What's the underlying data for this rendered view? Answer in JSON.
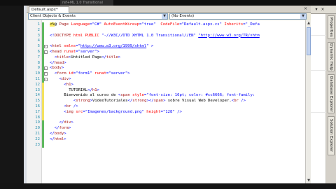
{
  "window": {
    "title": "ref+ML 1.0 Transitional"
  },
  "tab": {
    "label": "Default.aspx*",
    "close": "×"
  },
  "navbar": {
    "left_combo": "Client Objects & Events",
    "right_combo": "(No Events)"
  },
  "right_panel": {
    "tabs": [
      "Properties",
      "Dynamic Help",
      "Database Explorer",
      "Solution Explorer"
    ]
  },
  "code": {
    "lines": [
      {
        "n": "1",
        "mark": "green",
        "collapse": "",
        "indent": 0,
        "segs": [
          {
            "c": "t-asp",
            "t": "<%"
          },
          {
            "c": "t-text",
            "t": "@ "
          },
          {
            "c": "t-name",
            "t": "Page "
          },
          {
            "c": "t-attr",
            "t": "Language"
          },
          {
            "c": "t-val",
            "t": "=\"C#\" "
          },
          {
            "c": "t-attr",
            "t": "AutoEventWireup"
          },
          {
            "c": "t-val",
            "t": "=\"true\"  "
          },
          {
            "c": "t-attr",
            "t": "CodeFile"
          },
          {
            "c": "t-val",
            "t": "=\"Default.aspx.cs\" "
          },
          {
            "c": "t-attr",
            "t": "Inherits"
          },
          {
            "c": "t-val",
            "t": "=\"_Defa"
          }
        ]
      },
      {
        "n": "2",
        "mark": "green",
        "collapse": "",
        "indent": 0,
        "segs": []
      },
      {
        "n": "3",
        "mark": "green",
        "collapse": "",
        "indent": 0,
        "segs": [
          {
            "c": "t-tag",
            "t": "<!"
          },
          {
            "c": "t-name",
            "t": "DOCTYPE "
          },
          {
            "c": "t-attr",
            "t": "html PUBLIC "
          },
          {
            "c": "t-val",
            "t": "\"-//W3C//DTD XHTML 1.0 Transitional//EN\" "
          },
          {
            "c": "t-link",
            "t": "\"http://www.w3.org/TR/xhtm"
          }
        ]
      },
      {
        "n": "4",
        "mark": "green",
        "collapse": "",
        "indent": 0,
        "segs": []
      },
      {
        "n": "5",
        "mark": "green",
        "collapse": "-",
        "indent": 0,
        "segs": [
          {
            "c": "t-tag",
            "t": "<"
          },
          {
            "c": "t-name",
            "t": "html "
          },
          {
            "c": "t-attr",
            "t": "xmlns"
          },
          {
            "c": "t-val",
            "t": "=\""
          },
          {
            "c": "t-link",
            "t": "http://www.w3.org/1999/xhtml"
          },
          {
            "c": "t-val",
            "t": "\" "
          },
          {
            "c": "t-tag",
            "t": ">"
          }
        ]
      },
      {
        "n": "6",
        "mark": "green",
        "collapse": "-",
        "indent": 0,
        "segs": [
          {
            "c": "t-tag",
            "t": "<"
          },
          {
            "c": "t-name",
            "t": "head "
          },
          {
            "c": "t-attr",
            "t": "runat"
          },
          {
            "c": "t-val",
            "t": "=\"server\""
          },
          {
            "c": "t-tag",
            "t": ">"
          }
        ]
      },
      {
        "n": "7",
        "mark": "green",
        "collapse": "",
        "indent": 2,
        "segs": [
          {
            "c": "t-tag",
            "t": "<"
          },
          {
            "c": "t-name",
            "t": "title"
          },
          {
            "c": "t-tag",
            "t": ">"
          },
          {
            "c": "t-text",
            "t": "Untitled Page"
          },
          {
            "c": "t-tag",
            "t": "</"
          },
          {
            "c": "t-name",
            "t": "title"
          },
          {
            "c": "t-tag",
            "t": ">"
          }
        ]
      },
      {
        "n": "8",
        "mark": "green",
        "collapse": "",
        "indent": 0,
        "segs": [
          {
            "c": "t-tag",
            "t": "</"
          },
          {
            "c": "t-name",
            "t": "head"
          },
          {
            "c": "t-tag",
            "t": ">"
          }
        ]
      },
      {
        "n": "9",
        "mark": "green",
        "collapse": "-",
        "indent": 0,
        "segs": [
          {
            "c": "t-tag",
            "t": "<"
          },
          {
            "c": "t-name",
            "t": "body"
          },
          {
            "c": "t-tag",
            "t": ">"
          }
        ]
      },
      {
        "n": "10",
        "mark": "green",
        "collapse": "-",
        "indent": 2,
        "segs": [
          {
            "c": "t-tag",
            "t": "<"
          },
          {
            "c": "t-name",
            "t": "form "
          },
          {
            "c": "t-attr",
            "t": "id"
          },
          {
            "c": "t-val",
            "t": "=\"form1\" "
          },
          {
            "c": "t-attr",
            "t": "runat"
          },
          {
            "c": "t-val",
            "t": "=\"server\""
          },
          {
            "c": "t-tag",
            "t": ">"
          }
        ]
      },
      {
        "n": "11",
        "mark": "green",
        "collapse": "-",
        "indent": 4,
        "segs": [
          {
            "c": "t-tag",
            "t": "<"
          },
          {
            "c": "t-name",
            "t": "div"
          },
          {
            "c": "t-tag",
            "t": ">"
          }
        ]
      },
      {
        "n": "12",
        "mark": "yellow",
        "collapse": "",
        "indent": 6,
        "segs": [
          {
            "c": "t-tag",
            "t": "<"
          },
          {
            "c": "t-name",
            "t": "h1"
          },
          {
            "c": "t-tag",
            "t": ">"
          }
        ]
      },
      {
        "n": "13",
        "mark": "yellow",
        "collapse": "",
        "indent": 8,
        "segs": [
          {
            "c": "t-text",
            "t": "TUTORIAL"
          },
          {
            "c": "t-tag",
            "t": "</"
          },
          {
            "c": "t-name",
            "t": "h1"
          },
          {
            "c": "t-tag",
            "t": ">"
          }
        ]
      },
      {
        "n": "14",
        "mark": "yellow",
        "collapse": "",
        "indent": 6,
        "segs": [
          {
            "c": "t-text",
            "t": "Bienvenido al curso de "
          },
          {
            "c": "t-tag",
            "t": "<"
          },
          {
            "c": "t-name",
            "t": "span "
          },
          {
            "c": "t-attr",
            "t": "style"
          },
          {
            "c": "t-val",
            "t": "=\"font-size: 16pt; color: #cc6666; font-family:"
          }
        ]
      },
      {
        "n": "15",
        "mark": "yellow",
        "collapse": "",
        "indent": 10,
        "segs": [
          {
            "c": "t-tag",
            "t": "<"
          },
          {
            "c": "t-name",
            "t": "strong"
          },
          {
            "c": "t-tag",
            "t": ">"
          },
          {
            "c": "t-text",
            "t": "VideoTutoriales"
          },
          {
            "c": "t-tag",
            "t": "</"
          },
          {
            "c": "t-name",
            "t": "strong"
          },
          {
            "c": "t-tag",
            "t": "></"
          },
          {
            "c": "t-name",
            "t": "span"
          },
          {
            "c": "t-tag",
            "t": ">"
          },
          {
            "c": "t-text",
            "t": " sobre Visual Web Developer."
          },
          {
            "c": "t-tag",
            "t": "<"
          },
          {
            "c": "t-name",
            "t": "br "
          },
          {
            "c": "t-tag",
            "t": "/>"
          }
        ]
      },
      {
        "n": "16",
        "mark": "yellow",
        "collapse": "",
        "indent": 6,
        "segs": [
          {
            "c": "t-tag",
            "t": "<"
          },
          {
            "c": "t-name",
            "t": "br "
          },
          {
            "c": "t-tag",
            "t": "/>"
          }
        ]
      },
      {
        "n": "17",
        "mark": "yellow",
        "collapse": "",
        "indent": 6,
        "segs": [
          {
            "c": "t-tag",
            "t": "<"
          },
          {
            "c": "t-name",
            "t": "img "
          },
          {
            "c": "t-attr",
            "t": "src"
          },
          {
            "c": "t-val",
            "t": "=\"Imagenes/background.png\" "
          },
          {
            "c": "t-attr",
            "t": "height"
          },
          {
            "c": "t-val",
            "t": "=\"128\" "
          },
          {
            "c": "t-tag",
            "t": "/>"
          }
        ]
      },
      {
        "n": "18",
        "mark": "yellow",
        "collapse": "",
        "indent": 0,
        "segs": []
      },
      {
        "n": "19",
        "mark": "green",
        "collapse": "",
        "indent": 4,
        "segs": [
          {
            "c": "t-tag",
            "t": "</"
          },
          {
            "c": "t-name",
            "t": "div"
          },
          {
            "c": "t-tag",
            "t": ">"
          }
        ]
      },
      {
        "n": "20",
        "mark": "green",
        "collapse": "",
        "indent": 2,
        "segs": [
          {
            "c": "t-tag",
            "t": "</"
          },
          {
            "c": "t-name",
            "t": "form"
          },
          {
            "c": "t-tag",
            "t": ">"
          }
        ]
      },
      {
        "n": "21",
        "mark": "green",
        "collapse": "",
        "indent": 0,
        "segs": [
          {
            "c": "t-tag",
            "t": "</"
          },
          {
            "c": "t-name",
            "t": "body"
          },
          {
            "c": "t-tag",
            "t": ">"
          }
        ]
      },
      {
        "n": "22",
        "mark": "green",
        "collapse": "",
        "indent": 0,
        "segs": [
          {
            "c": "t-tag",
            "t": "</"
          },
          {
            "c": "t-name",
            "t": "html"
          },
          {
            "c": "t-tag",
            "t": ">"
          }
        ]
      },
      {
        "n": "23",
        "mark": "green",
        "collapse": "",
        "indent": 0,
        "segs": []
      }
    ]
  },
  "icons": {
    "combo_arrow": "chevron-down-icon",
    "scroll_up": "scroll-up-icon",
    "scroll_down": "scroll-down-icon",
    "pin": "pin-icon",
    "close": "close-icon"
  },
  "colors": {
    "tag": "#0000ff",
    "element": "#a31515",
    "attribute": "#ff0000",
    "aspx_directive": "#ffee62",
    "saved_change": "#5fb85f",
    "unsaved_change": "#f3e15e",
    "line_number": "#2b91af"
  }
}
